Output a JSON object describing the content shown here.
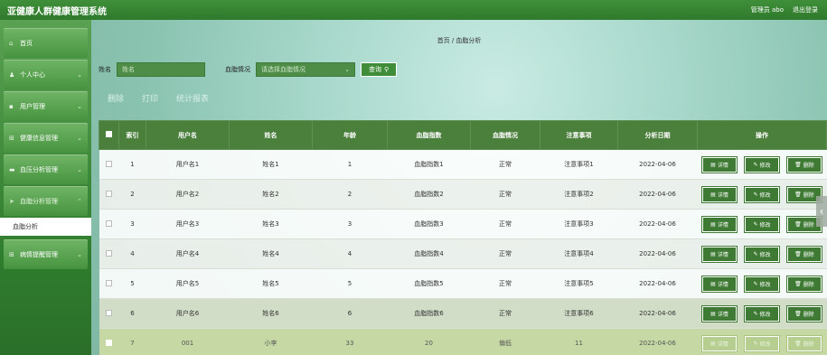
{
  "header": {
    "app_title": "亚健康人群健康管理系统",
    "user_label": "管理员 abo",
    "logout_label": "退出登录"
  },
  "sidebar": {
    "items": [
      {
        "label": "首页",
        "icon": "home-icon"
      },
      {
        "label": "个人中心",
        "icon": "person-icon"
      },
      {
        "label": "用户管理",
        "icon": "user-icon"
      },
      {
        "label": "健康信息管理",
        "icon": "grid-icon"
      },
      {
        "label": "血压分析管理",
        "icon": "list-icon"
      },
      {
        "label": "血脂分析管理",
        "icon": "send-icon"
      },
      {
        "label": "病情提醒管理",
        "icon": "grid-icon"
      }
    ],
    "submenu": {
      "label": "血脂分析"
    }
  },
  "breadcrumb": {
    "home": "首页",
    "sep": "/",
    "current": "血脂分析"
  },
  "search": {
    "name_label": "姓名",
    "name_placeholder": "姓名",
    "status_label": "血脂情况",
    "status_placeholder": "请选择血脂情况",
    "button_label": "查询"
  },
  "actions": {
    "delete": "删除",
    "print": "打印",
    "stats": "统计报表"
  },
  "table": {
    "headers": [
      "",
      "索引",
      "用户名",
      "姓名",
      "年龄",
      "血脂指数",
      "血脂情况",
      "注意事项",
      "分析日期",
      "操作"
    ],
    "buttons": {
      "detail": "详情",
      "edit": "修改",
      "delete": "删除"
    },
    "rows": [
      {
        "index": "1",
        "username": "用户名1",
        "name": "姓名1",
        "age": "1",
        "lipid_index": "血脂指数1",
        "lipid_status": "正常",
        "notes": "注意事项1",
        "date": "2022-04-06"
      },
      {
        "index": "2",
        "username": "用户名2",
        "name": "姓名2",
        "age": "2",
        "lipid_index": "血脂指数2",
        "lipid_status": "正常",
        "notes": "注意事项2",
        "date": "2022-04-06"
      },
      {
        "index": "3",
        "username": "用户名3",
        "name": "姓名3",
        "age": "3",
        "lipid_index": "血脂指数3",
        "lipid_status": "正常",
        "notes": "注意事项3",
        "date": "2022-04-06"
      },
      {
        "index": "4",
        "username": "用户名4",
        "name": "姓名4",
        "age": "4",
        "lipid_index": "血脂指数4",
        "lipid_status": "正常",
        "notes": "注意事项4",
        "date": "2022-04-06"
      },
      {
        "index": "5",
        "username": "用户名5",
        "name": "姓名5",
        "age": "5",
        "lipid_index": "血脂指数5",
        "lipid_status": "正常",
        "notes": "注意事项5",
        "date": "2022-04-06"
      },
      {
        "index": "6",
        "username": "用户名6",
        "name": "姓名6",
        "age": "6",
        "lipid_index": "血脂指数6",
        "lipid_status": "正常",
        "notes": "注意事项6",
        "date": "2022-04-06"
      },
      {
        "index": "7",
        "username": "001",
        "name": "小李",
        "age": "33",
        "lipid_index": "20",
        "lipid_status": "偏低",
        "notes": "11",
        "date": "2022-04-06"
      }
    ]
  },
  "colors": {
    "primary_green": "#3f8f3a",
    "header_row": "#4b7f3c",
    "accent_teal": "#a9d9cc"
  }
}
